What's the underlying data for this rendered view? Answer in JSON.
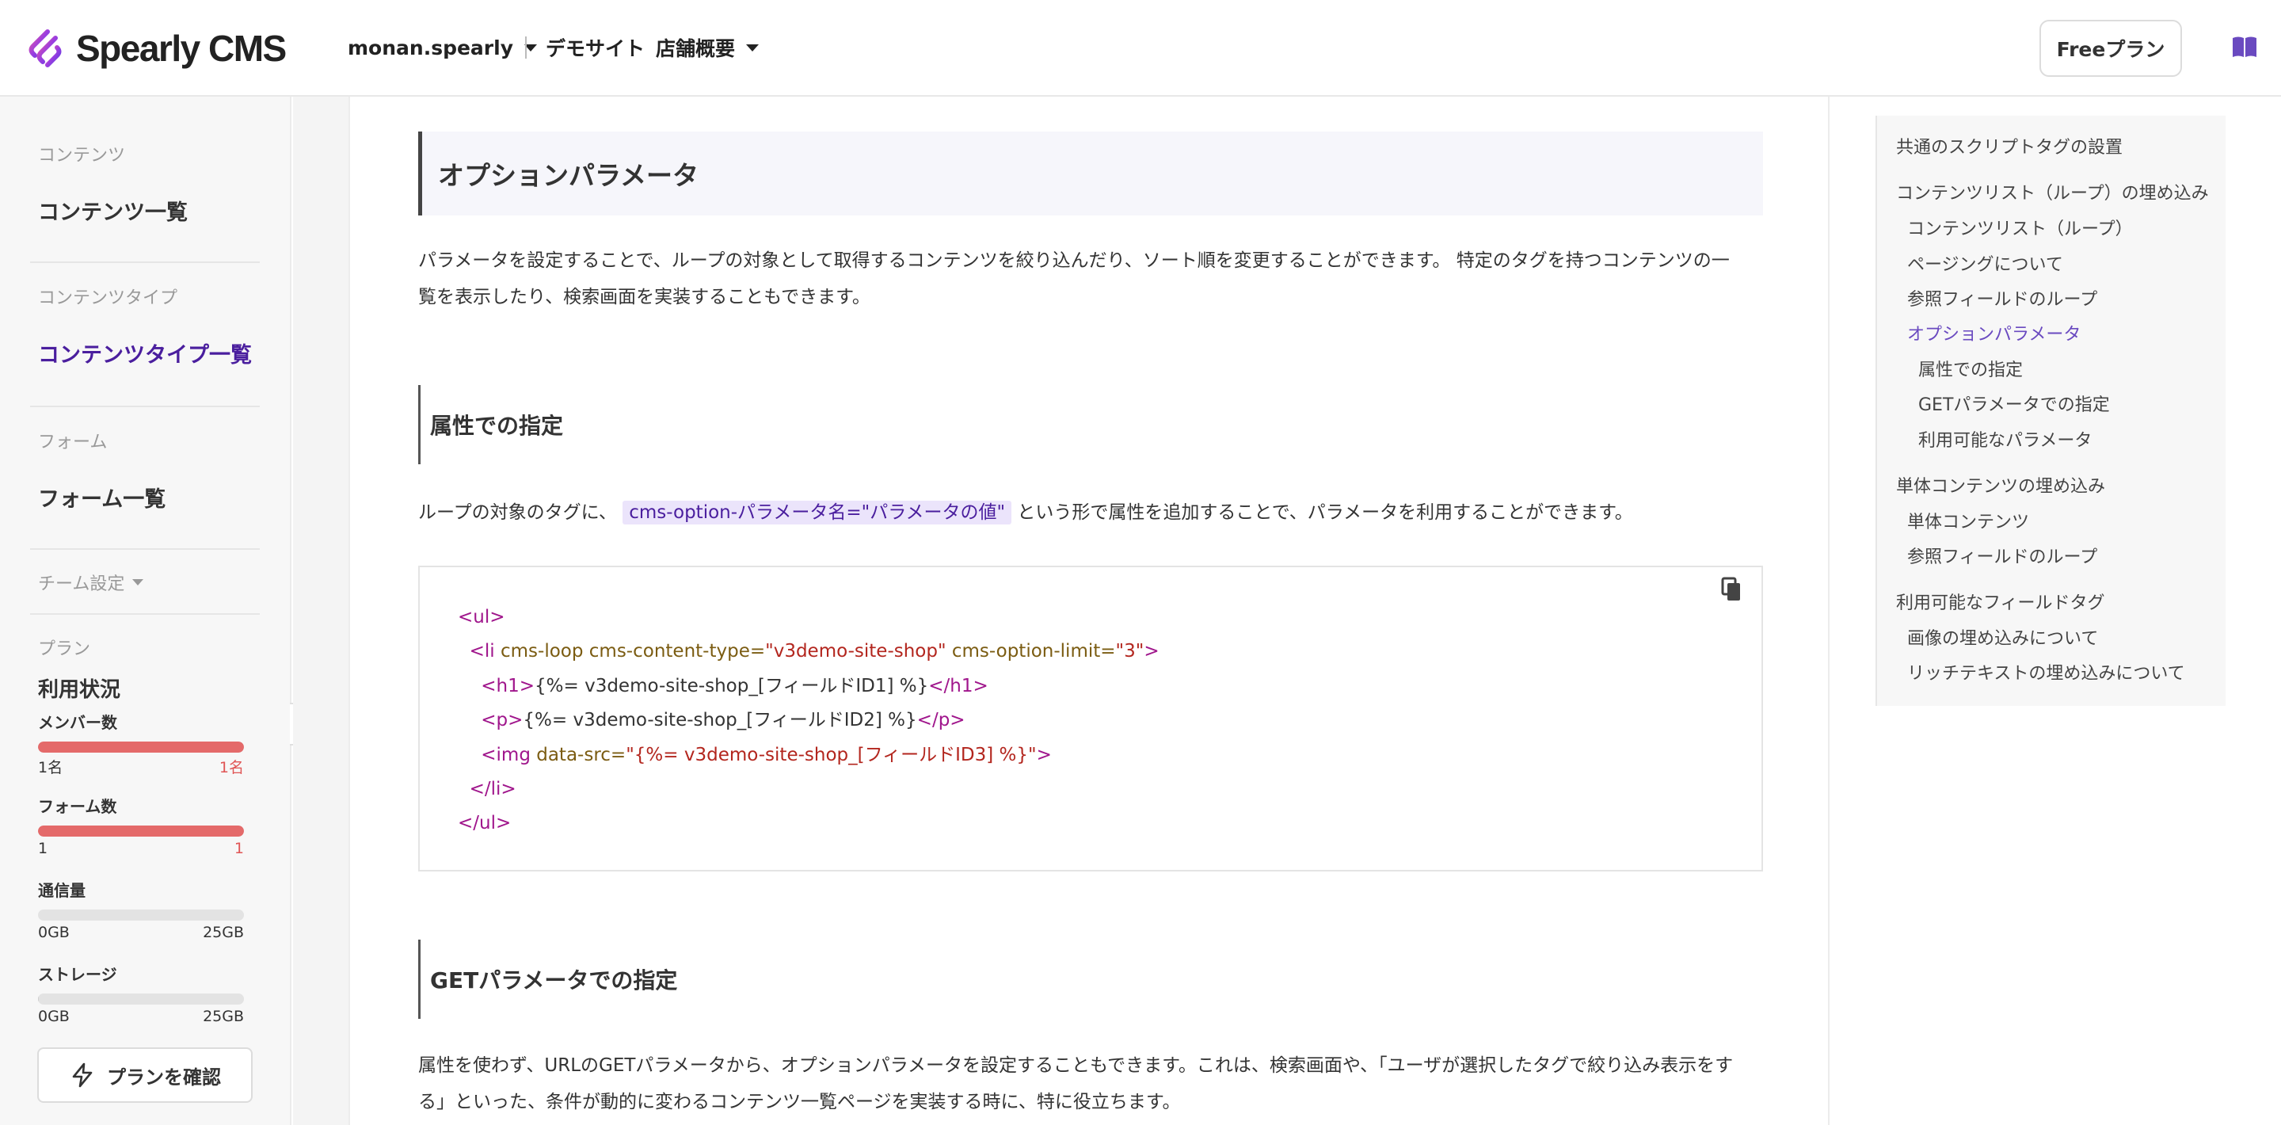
{
  "header": {
    "brand": "Spearly CMS",
    "team": "monan.spearly",
    "site": "デモサイト",
    "page": "店舗概要",
    "plan_button": "Freeプラン",
    "icons": {
      "logo": "spearly-logo-icon",
      "docs": "book-icon"
    }
  },
  "sidebar": {
    "sections": [
      {
        "category": "コンテンツ",
        "link": "コンテンツ一覧",
        "active": false
      },
      {
        "category": "コンテンツタイプ",
        "link": "コンテンツタイプ一覧",
        "active": true
      },
      {
        "category": "フォーム",
        "link": "フォーム一覧",
        "active": false
      }
    ],
    "team_settings": "チーム設定",
    "plan_category": "プラン",
    "usage_title": "利用状況",
    "meters": [
      {
        "label": "メンバー数",
        "min": "1名",
        "max": "1名",
        "fraction": 1.0,
        "status": "full"
      },
      {
        "label": "フォーム数",
        "min": "1",
        "max": "1",
        "fraction": 1.0,
        "status": "full"
      },
      {
        "label": "通信量",
        "min": "0GB",
        "max": "25GB",
        "fraction": 0.0,
        "status": "normal"
      },
      {
        "label": "ストレージ",
        "min": "0GB",
        "max": "25GB",
        "fraction": 0.005,
        "status": "normal"
      }
    ],
    "plan_confirm": "プランを確認",
    "icons": {
      "plan_confirm": "lightning-icon",
      "collapse": "chevron-left-icon"
    }
  },
  "main": {
    "h2": "オプションパラメータ",
    "intro_line1": "パラメータを設定することで、ループの対象として取得するコンテンツを絞り込んだり、ソート順を変更することができます。 特定のタグを持つコンテンツの一",
    "intro_line2": "覧を表示したり、検索画面を実装することもできます。",
    "h3_attr": "属性での指定",
    "attr_text_before": "ループの対象のタグに、 ",
    "attr_code": "cms-option-パラメータ名=\"パラメータの値\"",
    "attr_text_after": " という形で属性を追加することで、パラメータを利用することができます。",
    "code": {
      "l1_open": "<ul>",
      "l2_open": "<li ",
      "l2_attr1": "cms-loop cms-content-type=",
      "l2_val1": "\"v3demo-site-shop\"",
      "l2_attr2": " cms-option-limit=",
      "l2_val2": "\"3\"",
      "l2_close": ">",
      "l3_open": "<h1>",
      "l3_text": "{%= v3demo-site-shop_[フィールドID1] %}",
      "l3_close": "</h1>",
      "l4_open": "<p>",
      "l4_text": "{%= v3demo-site-shop_[フィールドID2] %}",
      "l4_close": "</p>",
      "l5_open": "<img ",
      "l5_attr": "data-src=",
      "l5_val": "\"{%= v3demo-site-shop_[フィールドID3] %}\"",
      "l5_close": ">",
      "l6": "</li>",
      "l7": "</ul>",
      "copy_icon": "copy-icon"
    },
    "h3_get": "GETパラメータでの指定",
    "get_line1": "属性を使わず、URLのGETパラメータから、オプションパラメータを設定することもできます。これは、検索画面や、「ユーザが選択したタグで絞り込み表示をす",
    "get_line2": "る」といった、条件が動的に変わるコンテンツ一覧ページを実装する時に、特に役立ちます。"
  },
  "toc": {
    "items": [
      {
        "label": "共通のスクリプトタグの設置",
        "level": 0,
        "active": false
      },
      {
        "label": "コンテンツリスト（ループ）の埋め込み",
        "level": 0,
        "active": false
      },
      {
        "label": "コンテンツリスト（ループ）",
        "level": 1,
        "active": false
      },
      {
        "label": "ページングについて",
        "level": 1,
        "active": false
      },
      {
        "label": "参照フィールドのループ",
        "level": 1,
        "active": false
      },
      {
        "label": "オプションパラメータ",
        "level": 1,
        "active": true
      },
      {
        "label": "属性での指定",
        "level": 2,
        "active": false
      },
      {
        "label": "GETパラメータでの指定",
        "level": 2,
        "active": false
      },
      {
        "label": "利用可能なパラメータ",
        "level": 2,
        "active": false
      },
      {
        "label": "単体コンテンツの埋め込み",
        "level": 0,
        "active": false
      },
      {
        "label": "単体コンテンツ",
        "level": 1,
        "active": false
      },
      {
        "label": "参照フィールドのループ",
        "level": 1,
        "active": false
      },
      {
        "label": "利用可能なフィールドタグ",
        "level": 0,
        "active": false
      },
      {
        "label": "画像の埋め込みについて",
        "level": 1,
        "active": false
      },
      {
        "label": "リッチテキストの埋め込みについて",
        "level": 1,
        "active": false
      }
    ]
  }
}
